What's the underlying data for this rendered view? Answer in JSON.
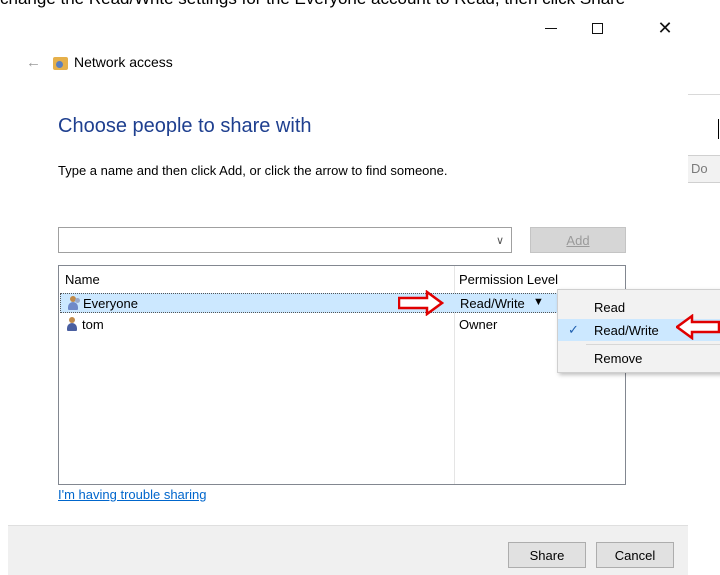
{
  "caption": "change the Read/Write settings for the Everyone account to Read, then click Share",
  "window": {
    "back_label": "←",
    "app_title": "Network access",
    "minimize_glyph": "—",
    "maximize_glyph": "☐",
    "close_glyph": "✕"
  },
  "main": {
    "heading": "Choose people to share with",
    "instructions": "Type a name and then click Add, or click the arrow to find someone.",
    "name_input": {
      "value": "",
      "placeholder": ""
    },
    "add_label": "Add",
    "list": {
      "columns": [
        "Name",
        "Permission Level"
      ],
      "rows": [
        {
          "name": "Everyone",
          "permission": "Read/Write",
          "selected": true,
          "icon": "group-icon"
        },
        {
          "name": "tom",
          "permission": "Owner",
          "selected": false,
          "icon": "user-icon"
        }
      ]
    },
    "trouble_link": "I'm having trouble sharing"
  },
  "context_menu": {
    "items": [
      {
        "label": "Read",
        "checked": false
      },
      {
        "label": "Read/Write",
        "checked": true
      },
      {
        "label": "Remove",
        "checked": false
      }
    ]
  },
  "footer": {
    "share_label": "Share",
    "cancel_label": "Cancel"
  },
  "background_window": {
    "field_text": "Do"
  },
  "colors": {
    "heading": "#1e3f8f",
    "link": "#0066cc",
    "selection": "#cce8ff",
    "annotation": "#e00000"
  }
}
